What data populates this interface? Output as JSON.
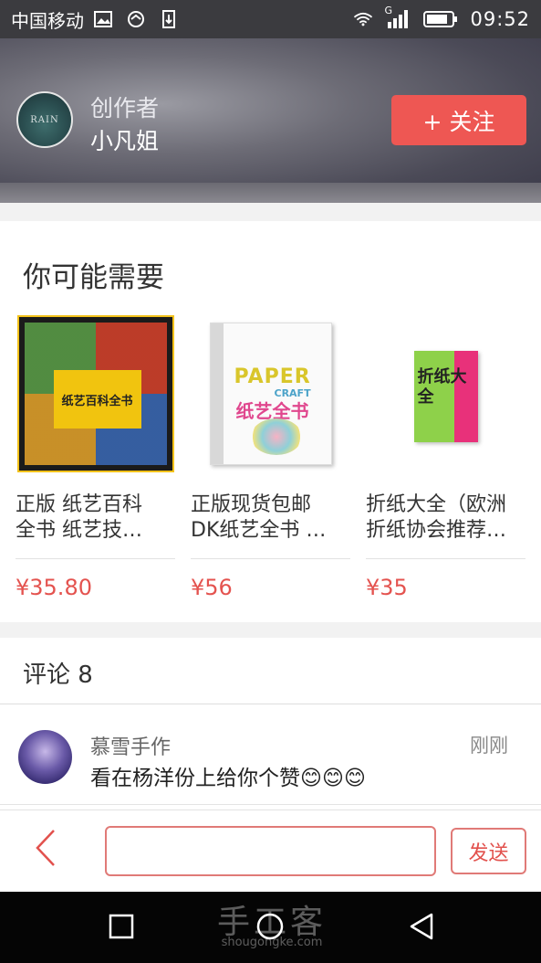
{
  "status_bar": {
    "carrier": "中国移动",
    "network": "G",
    "time": "09:52",
    "icons": [
      "image-icon",
      "sync-icon",
      "download-icon",
      "wifi-icon",
      "signal-icon",
      "battery-icon"
    ]
  },
  "header": {
    "avatar_text": "RAIN",
    "role": "创作者",
    "name": "小凡姐",
    "follow_label": "+ 关注"
  },
  "recommendations": {
    "title": "你可能需要",
    "items": [
      {
        "name_line1": "正版 纸艺百科",
        "name_line2": "全书 纸艺技…",
        "price": "¥35.80",
        "cover_text": "纸艺百科全书"
      },
      {
        "name_line1": "正版现货包邮",
        "name_line2": "DK纸艺全书 …",
        "price": "¥56",
        "cover_text_en": "PAPER",
        "cover_text_en2": "CRAFT",
        "cover_text_zh": "纸艺全书"
      },
      {
        "name_line1": "折纸大全（欧洲",
        "name_line2": "折纸协会推荐…",
        "price": "¥35",
        "cover_text": "折纸大全"
      }
    ]
  },
  "comments": {
    "title": "评论 8",
    "items": [
      {
        "author": "慕雪手作",
        "time": "刚刚",
        "text": "看在杨洋份上给你个赞😊😊😊"
      }
    ]
  },
  "input_bar": {
    "placeholder": "",
    "send_label": "发送"
  },
  "watermark": {
    "title": "手工客",
    "url": "shougongke.com"
  },
  "colors": {
    "accent": "#ee5753",
    "price": "#e4534f"
  }
}
